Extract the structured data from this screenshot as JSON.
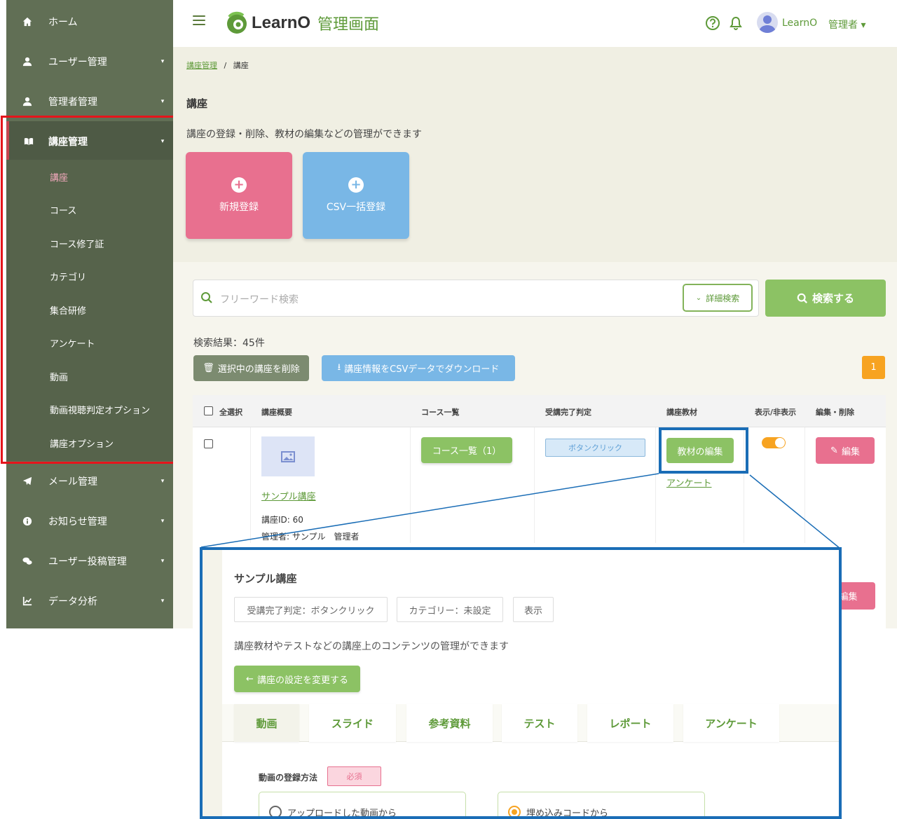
{
  "sidebar": {
    "items": [
      {
        "label": "ホーム",
        "icon": "home-icon",
        "caret": false
      },
      {
        "label": "ユーザー管理",
        "icon": "user-icon",
        "caret": true
      },
      {
        "label": "管理者管理",
        "icon": "admin-icon",
        "caret": true
      },
      {
        "label": "講座管理",
        "icon": "book-icon",
        "caret": true,
        "active": true
      },
      {
        "label": "メール管理",
        "icon": "paper-plane-icon",
        "caret": true
      },
      {
        "label": "お知らせ管理",
        "icon": "info-icon",
        "caret": true
      },
      {
        "label": "ユーザー投稿管理",
        "icon": "comments-icon",
        "caret": true
      },
      {
        "label": "データ分析",
        "icon": "chart-line-icon",
        "caret": true
      }
    ],
    "subitems": [
      "講座",
      "コース",
      "コース修了証",
      "カテゴリ",
      "集合研修",
      "アンケート",
      "動画",
      "動画視聴判定オプション",
      "講座オプション"
    ],
    "caret_glyph": "▾"
  },
  "header": {
    "logo_text": "LearnO",
    "logo_sub": "管理画面",
    "user_name": "LearnO",
    "user_role": "管理者 ▾"
  },
  "breadcrumb": {
    "parent": "講座管理",
    "sep": "/",
    "current": "講座"
  },
  "page": {
    "title": "講座",
    "description": "講座の登録・削除、教材の編集などの管理ができます",
    "new_label": "新規登録",
    "csv_label": "CSV一括登録"
  },
  "search": {
    "placeholder": "フリーワード検索",
    "detail_label": "詳細検索",
    "search_label": "検索する"
  },
  "results": {
    "count": "検索結果：45件",
    "delete_label": "選択中の講座を削除",
    "download_label": "講座情報をCSVデータでダウンロード",
    "page": "1"
  },
  "table": {
    "headers": [
      "全選択",
      "講座概要",
      "コース一覧",
      "受講完了判定",
      "講座教材",
      "表示/非表示",
      "編集・削除"
    ],
    "row": {
      "name": "サンプル講座",
      "course_id": "講座ID: 60",
      "admin": "管理者: サンプル　管理者",
      "course_list": "コース一覧（1）",
      "judge": "ボタンクリック",
      "material": "教材の編集",
      "survey": "アンケート",
      "visible": true,
      "edit": "編集"
    },
    "row2_edit": "編集"
  },
  "zoom": {
    "title": "サンプル講座",
    "tags": [
      "受講完了判定：ボタンクリック",
      "カテゴリー：未設定",
      "表示"
    ],
    "description": "講座教材やテストなどの講座上のコンテンツの管理ができます",
    "back_label": "講座の設定を変更する",
    "tabs": [
      "動画",
      "スライド",
      "参考資料",
      "テスト",
      "レポート",
      "アンケート"
    ],
    "reg_label": "動画の登録方法",
    "required": "必須",
    "options": [
      "アップロードした動画から",
      "埋め込みコードから"
    ]
  },
  "colors": {
    "sidebar": "#616f55",
    "accent_green": "#8cc264",
    "pink": "#e8708f",
    "blue": "#79b7e6",
    "highlight_red": "#e6141b",
    "highlight_blue": "#1a6db6"
  }
}
